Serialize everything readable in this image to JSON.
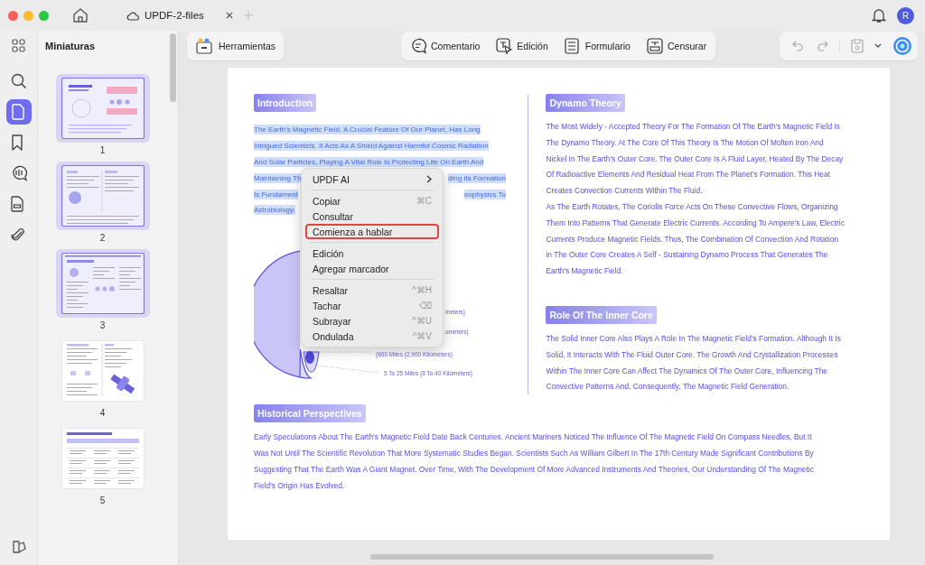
{
  "window": {
    "tab_title": "UPDF-2-files",
    "avatar": "R"
  },
  "toolbar": {
    "tools_button": "Herramientas",
    "modes": [
      {
        "kind": "comment",
        "label": "Comentario"
      },
      {
        "kind": "edit",
        "label": "Edición"
      },
      {
        "kind": "form",
        "label": "Formulario"
      },
      {
        "kind": "redact",
        "label": "Censurar"
      }
    ]
  },
  "rail": [
    {
      "kind": "search",
      "selected": false
    },
    {
      "kind": "pages",
      "selected": true
    },
    {
      "kind": "bookmark",
      "selected": false
    },
    {
      "kind": "comment",
      "selected": false
    },
    {
      "kind": "form",
      "selected": false
    },
    {
      "kind": "attachment",
      "selected": false
    }
  ],
  "sidebar": {
    "title": "Miniaturas",
    "thumbnails": [
      {
        "label": "1",
        "selected": true,
        "kind": "cover"
      },
      {
        "label": "2",
        "selected": true,
        "kind": "two-column"
      },
      {
        "label": "3",
        "selected": true,
        "kind": "three-column"
      },
      {
        "label": "4",
        "selected": false,
        "kind": "satellite"
      },
      {
        "label": "5",
        "selected": false,
        "kind": "table"
      }
    ]
  },
  "document": {
    "introduction": {
      "heading": "Introduction",
      "selected": true,
      "lines": [
        {
          "left": "The Earth's Magnetic Field, A Crucial Feature Of Our Planet, Has Long"
        },
        {
          "left": "Intrigued Scientists. It Acts As A Shield Against Harmful Cosmic Radiation"
        },
        {
          "left": "And Solar Particles, Playing A Vital Role In Protecting Life On Earth And"
        },
        {
          "left": "Maintaining Th",
          "right": "ding Its Formation"
        },
        {
          "left": "Is Fundament",
          "right": "eophysics To"
        },
        {
          "left": "Astrobiology."
        }
      ]
    },
    "diagram_labels": [
      "meters)",
      "ometers)",
      "(800 Miles (2,900 Kilometers)",
      "5 To 25 Miles (8 To 40 Kilometers)"
    ],
    "dynamo": {
      "heading": "Dynamo Theory",
      "paragraphs": [
        "The Most Widely - Accepted Theory For The Formation Of The Earth's Magnetic Field Is The Dynamo Theory. At The Core Of This Theory Is The Motion Of Molten Iron And Nickel In The Earth's Outer Core. The Outer Core Is A Fluid Layer, Heated By The Decay Of Radioactive Elements And Residual Heat From The Planet's Formation. This Heat Creates Convection Currents Within The Fluid.",
        "As The Earth Rotates, The Coriolis Force Acts On These Convective Flows, Organizing Them Into Patterns That Generate Electric Currents. According To Ampere's Law, Electric Currents Produce Magnetic Fields. Thus, The Combination Of Convection And Rotation in The Outer Core Creates A Self - Sustaining Dynamo Process That Generates The Earth's Magnetic Field."
      ]
    },
    "inner_core": {
      "heading": "Role Of The Inner Core",
      "paragraphs": [
        "The Solid Inner Core Also Plays A Role In The Magnetic Field's Formation. Although It Is Solid, It Interacts With The Fluid Outer Core. The Growth And Crystallization Processes Within The Inner Core Can Affect The Dynamics Of The Outer Core, Influencing The Convective Patterns And, Consequently, The Magnetic Field Generation."
      ]
    },
    "history": {
      "heading": "Historical Perspectives",
      "paragraphs": [
        "Early Speculations About The Earth's Magnetic Field Date Back Centuries. Ancient Mariners Noticed The Influence Of The Magnetic Field On Compass Needles, But It Was Not Until The Scientific Revolution That More Systematic Studies Began. Scientists Such As William Gilbert In The 17th Century Made Significant Contributions By Suggesting That The Earth Was A Giant Magnet. Over Time, With The Development Of More Advanced Instruments And Theories, Our Understanding Of The Magnetic Field's Origin Has Evolved."
      ]
    }
  },
  "context_menu": {
    "items": [
      {
        "kind": "item",
        "label": "UPDF AI",
        "submenu": true,
        "highlighted": false
      },
      {
        "kind": "separator"
      },
      {
        "kind": "item",
        "label": "Copiar",
        "shortcut": "⌘C",
        "submenu": false,
        "highlighted": false
      },
      {
        "kind": "item",
        "label": "Consultar",
        "submenu": false,
        "highlighted": false
      },
      {
        "kind": "item",
        "label": "Comienza a hablar",
        "submenu": false,
        "highlighted": true
      },
      {
        "kind": "separator"
      },
      {
        "kind": "item",
        "label": "Edición",
        "submenu": false,
        "highlighted": false
      },
      {
        "kind": "item",
        "label": "Agregar marcador",
        "submenu": false,
        "highlighted": false
      },
      {
        "kind": "separator"
      },
      {
        "kind": "item",
        "label": "Resaltar",
        "shortcut": "^⌘H",
        "submenu": false,
        "highlighted": false
      },
      {
        "kind": "item",
        "label": "Tachar",
        "shortcut": "⌫",
        "submenu": false,
        "highlighted": false
      },
      {
        "kind": "item",
        "label": "Subrayar",
        "shortcut": "^⌘U",
        "submenu": false,
        "highlighted": false
      },
      {
        "kind": "item",
        "label": "Ondulada",
        "shortcut": "^⌘V",
        "submenu": false,
        "highlighted": false
      }
    ]
  }
}
